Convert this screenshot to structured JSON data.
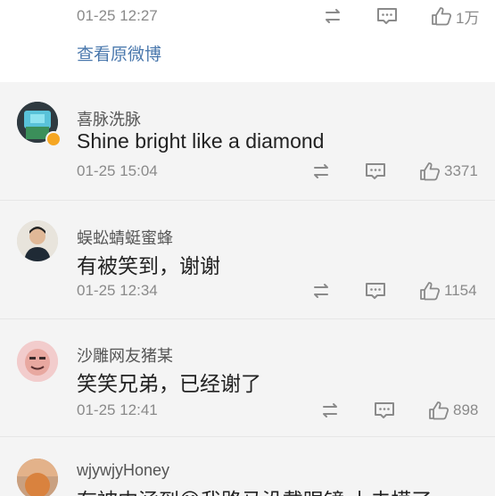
{
  "top_post": {
    "time": "01-25 12:27",
    "like_count": "1万",
    "view_original_label": "查看原微博"
  },
  "comments": [
    {
      "username": "喜脉洗脉",
      "text": "Shine bright like a diamond",
      "time": "01-25 15:04",
      "like_count": "3371",
      "verified": true
    },
    {
      "username": "蜈蚣蜻蜓蜜蜂",
      "text": "有被笑到，谢谢",
      "time": "01-25 12:34",
      "like_count": "1154"
    },
    {
      "username": "沙雕网友猪某",
      "text": "笑笑兄弟，已经谢了",
      "time": "01-25 12:41",
      "like_count": "898"
    },
    {
      "username": "wjywjyHoney",
      "text": "有被内涵到😊我路马没戴眼镜 上去摸了一"
    }
  ],
  "colors": {
    "link": "#4a78ad",
    "meta_text": "#8a8a8a",
    "comment_bg": "#f4f4f4",
    "top_bg": "#ffffff",
    "verified_badge": "#f5a623"
  },
  "icons": [
    "repost-icon",
    "comment-icon",
    "like-icon"
  ]
}
